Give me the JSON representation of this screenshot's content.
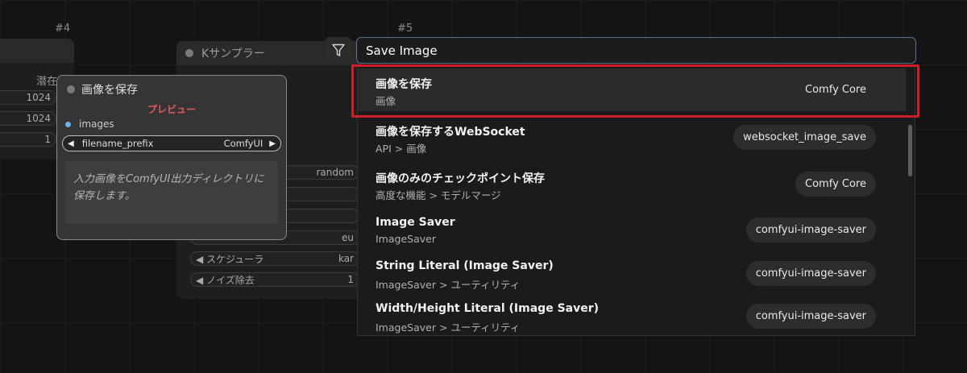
{
  "canvas": {
    "node_ids": [
      "#4",
      "#5"
    ]
  },
  "left_node": {
    "label": "潜在",
    "values": [
      "1024",
      "1024",
      "1"
    ]
  },
  "ksampler": {
    "title": "Kサンプラー",
    "widgets": [
      "random",
      "eu",
      "スケジューラ",
      "kar",
      "ノイズ除去",
      "1"
    ]
  },
  "save_node": {
    "title": "画像を保存",
    "preview_label": "プレビュー",
    "input_label": "images",
    "widget_name": "filename_prefix",
    "widget_value": "ComfyUI",
    "description": "入力画像をComfyUI出力ディレクトリに保存します。"
  },
  "search": {
    "value": "Save Image"
  },
  "results": [
    {
      "name": "画像を保存",
      "category": "画像",
      "source": "Comfy Core"
    },
    {
      "name": "画像を保存するWebSocket",
      "category": "API > 画像",
      "source": "websocket_image_save"
    },
    {
      "name": "画像のみのチェックポイント保存",
      "category": "高度な機能 > モデルマージ",
      "source": "Comfy Core"
    },
    {
      "name": "Image Saver",
      "category": "ImageSaver",
      "source": "comfyui-image-saver"
    },
    {
      "name": "String Literal (Image Saver)",
      "category": "ImageSaver > ユーティリティ",
      "source": "comfyui-image-saver"
    },
    {
      "name": "Width/Height Literal (Image Saver)",
      "category": "ImageSaver > ユーティリティ",
      "source": "comfyui-image-saver"
    }
  ],
  "colors": {
    "highlight": "#d11d2a",
    "preview_label": "#e05a5a",
    "input_dot": "#6ab4f0"
  }
}
